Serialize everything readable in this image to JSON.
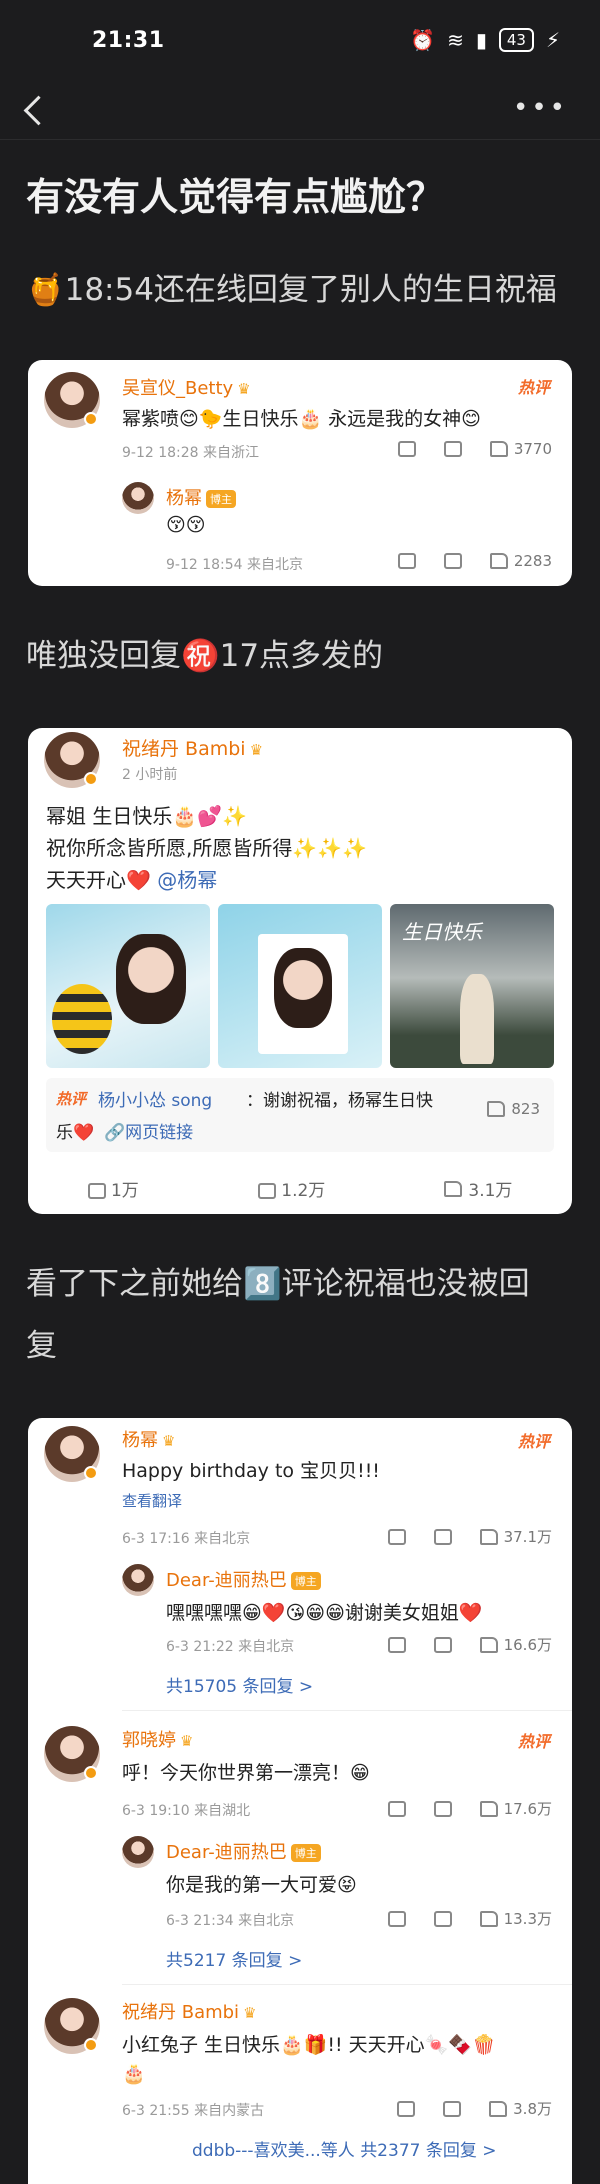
{
  "status_bar": {
    "time": "21:31",
    "battery": "43"
  },
  "nav": {
    "more": "•••"
  },
  "post": {
    "title": "有没有人觉得有点尴尬？",
    "para1": "🍯18:54还在线回复了别人的生日祝福",
    "para2": "唯独没回复㊗️17点多发的",
    "para3_line1": "看了下之前她给8️⃣评论祝福也没被回",
    "para3_line2": "复"
  },
  "card1": {
    "comment": {
      "user": "吴宣仪_Betty",
      "hot": "热评",
      "text": "幂紫喷😊🐤生日快乐🎂 永远是我的女神😊",
      "meta": "9-12 18:28  来自浙江",
      "likes": "3770"
    },
    "reply": {
      "user": "杨幂",
      "badge": "博主",
      "text": "😚😚",
      "meta": "9-12 18:54  来自北京",
      "likes": "2283"
    }
  },
  "card2": {
    "user": "祝绪丹 Bambi",
    "time": "2 小时前",
    "line1": "幂姐 生日快乐🎂💕✨",
    "line2": "祝你所念皆所愿,所愿皆所得✨✨✨",
    "line3": "天天开心❤️",
    "mention": "@杨幂",
    "photo_caption": "生日快乐",
    "hot_label": "热评",
    "hot_user": "杨小小怂 song",
    "hot_text_1": "：谢谢祝福，杨幂生日快",
    "hot_text_2": "乐❤️",
    "hot_link": "🔗网页链接",
    "hot_likes": "823",
    "reposts": "1万",
    "comments": "1.2万",
    "likes": "3.1万"
  },
  "card3": {
    "c1": {
      "user": "杨幂",
      "hot": "热评",
      "text": "Happy birthday to 宝贝贝!!!",
      "translate": "查看翻译",
      "meta": "6-3 17:16  来自北京",
      "likes": "37.1万",
      "reply_user": "Dear-迪丽热巴",
      "reply_badge": "博主",
      "reply_text": "嘿嘿嘿嘿😁❤️😘😁😁谢谢美女姐姐❤️",
      "reply_meta": "6-3 21:22  来自北京",
      "reply_likes": "16.6万",
      "more": "共15705 条回复 >"
    },
    "c2": {
      "user": "郭晓婷",
      "hot": "热评",
      "text": "呼！今天你世界第一漂亮！😁",
      "meta": "6-3 19:10  来自湖北",
      "likes": "17.6万",
      "reply_user": "Dear-迪丽热巴",
      "reply_badge": "博主",
      "reply_text": "你是我的第一大可爱😝",
      "reply_meta": "6-3 21:34  来自北京",
      "reply_likes": "13.3万",
      "more": "共5217 条回复 >"
    },
    "c3": {
      "user": "祝绪丹 Bambi",
      "text": "小红兔子 生日快乐🎂🎁!! 天天开心🍬🍫🍿",
      "text2": "🎂",
      "meta": "6-3 21:55  来自内蒙古",
      "likes": "3.8万",
      "more_users": "ddbb---喜欢美...等人",
      "more": "共2377 条回复 >"
    }
  }
}
